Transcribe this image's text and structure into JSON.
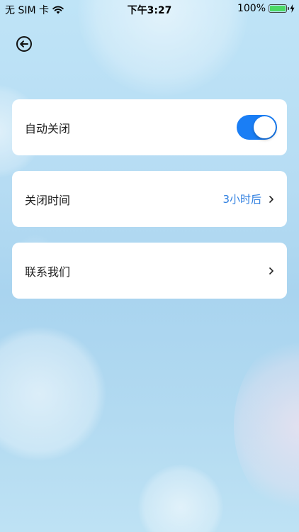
{
  "status_bar": {
    "carrier": "无 SIM 卡",
    "time": "下午3:27",
    "battery": "100%",
    "battery_level": 1.0,
    "wifi_icon": "wifi-icon",
    "charging_icon": "bolt-icon"
  },
  "nav": {
    "back_icon": "back-arrow-icon"
  },
  "settings": {
    "auto_close": {
      "label": "自动关闭",
      "enabled": true
    },
    "close_time": {
      "label": "关闭时间",
      "value": "3小时后"
    },
    "contact": {
      "label": "联系我们"
    }
  },
  "colors": {
    "accent": "#1a7ef5",
    "value_text": "#2f7fe0",
    "battery_green": "#4cd964"
  }
}
